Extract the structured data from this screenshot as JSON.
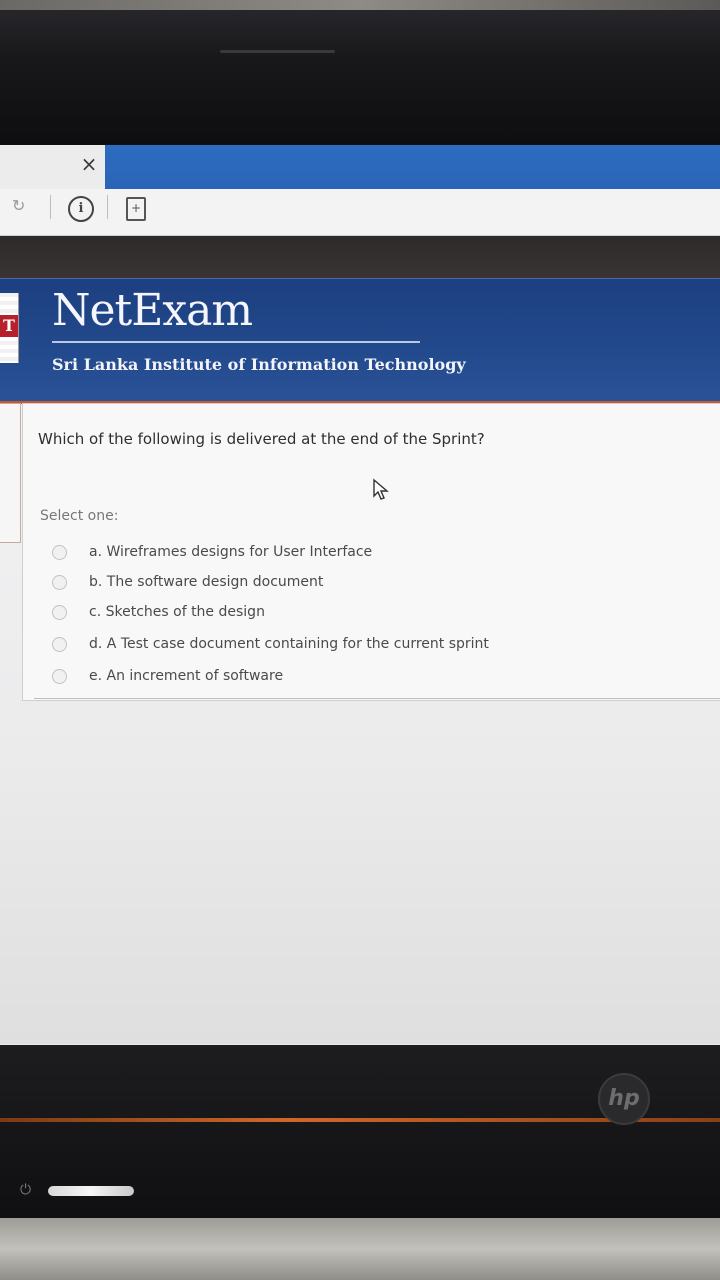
{
  "browser": {
    "close_symbol": "×",
    "info_symbol": "i",
    "reload_symbol": "↻"
  },
  "header": {
    "brand": "NetExam",
    "institute": "Sri Lanka Institute of Information Technology",
    "logo_letter": "T"
  },
  "quiz": {
    "question": "Which of the following is delivered at the end of the Sprint?",
    "select_label": "Select one:",
    "options": [
      "a. Wireframes designs for User Interface",
      "b. The software design document",
      "c. Sketches of the design",
      "d. A Test case document containing for the current sprint",
      "e. An increment of software"
    ]
  },
  "device": {
    "logo": "hp"
  },
  "colors": {
    "header_blue": "#234a8d",
    "accent_orange": "#c5582e",
    "tab_blue": "#2d6cc0"
  }
}
